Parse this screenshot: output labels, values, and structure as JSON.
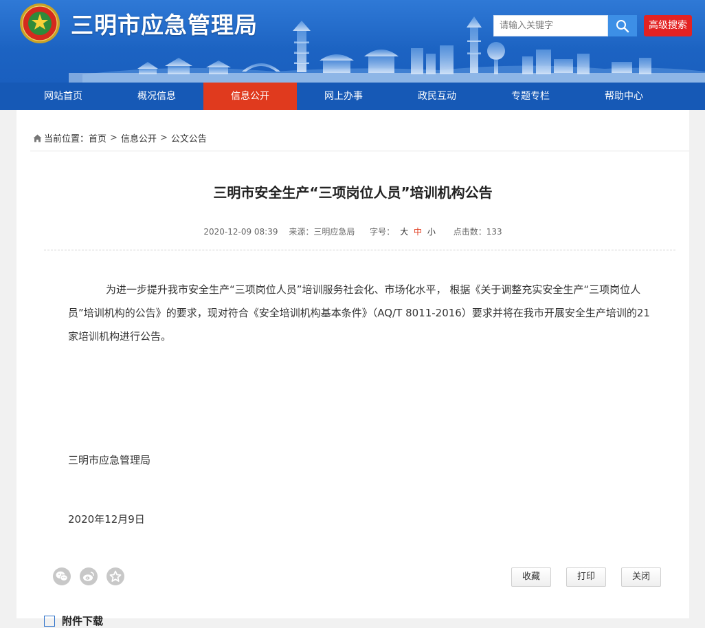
{
  "header": {
    "site_title": "三明市应急管理局",
    "search_placeholder": "请输入关键字",
    "advanced_search_label": "高级搜索"
  },
  "nav": {
    "items": [
      {
        "label": "网站首页"
      },
      {
        "label": "概况信息"
      },
      {
        "label": "信息公开"
      },
      {
        "label": "网上办事"
      },
      {
        "label": "政民互动"
      },
      {
        "label": "专题专栏"
      },
      {
        "label": "帮助中心"
      }
    ],
    "active_index": 2
  },
  "breadcrumb": {
    "prefix": "当前位置：",
    "items": [
      "首页",
      "信息公开",
      "公文公告"
    ],
    "separator": ">"
  },
  "article": {
    "title": "三明市安全生产“三项岗位人员”培训机构公告",
    "date": "2020-12-09 08:39",
    "source": "来源：三明应急局",
    "font_size_label": "字号：",
    "font_sizes": [
      "大",
      "中",
      "小"
    ],
    "font_size_selected": "中",
    "view_count": "点击数：133",
    "body": "为进一步提升我市安全生产“三项岗位人员”培训服务社会化、市场化水平， 根据《关于调整充实安全生产“三项岗位人员”培训机构的公告》的要求，现对符合《安全培训机构基本条件》（AQ/T 8011-2016）要求并将在我市开展安全生产培训的21家培训机构进行公告。",
    "signature": "三明市应急管理局",
    "sign_date": "2020年12月9日"
  },
  "share": {
    "icons": [
      "wechat-icon",
      "weibo-icon",
      "favorite-star-icon"
    ]
  },
  "actions": {
    "collect_label": "收藏",
    "print_label": "打印",
    "close_label": "关闭"
  },
  "attachment": {
    "title": "附件下载"
  },
  "colors": {
    "header_blue": "#1c63c2",
    "nav_blue": "#1659b6",
    "nav_active": "#e03a1e",
    "advanced_search_red": "#e32222",
    "search_button_blue": "#3d8fe6"
  }
}
